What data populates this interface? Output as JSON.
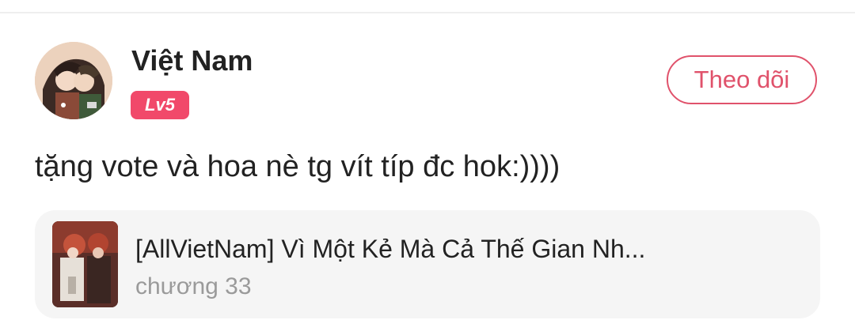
{
  "comment": {
    "user": {
      "name": "Việt Nam",
      "level": "Lv5",
      "avatar": "anime-style-avatar-image"
    },
    "follow_button_label": "Theo dõi",
    "text": "tặng vote và hoa nè tg vít típ đc hok:))))"
  },
  "story_card": {
    "title": "[AllVietNam] Vì Một Kẻ Mà Cả Thế Gian Nh...",
    "chapter": "chương 33",
    "cover": "story-cover-image"
  },
  "colors": {
    "accent": "#e0526b",
    "badge": "#f1496a",
    "card_bg": "#f5f5f5",
    "muted_text": "#9a9a9a"
  }
}
